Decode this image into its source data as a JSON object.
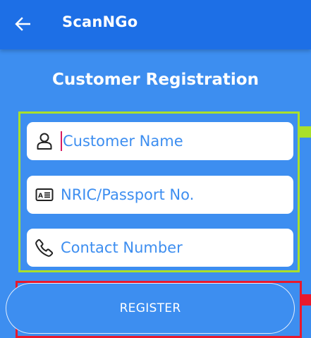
{
  "appbar": {
    "title": "ScanNGo",
    "back_icon": "arrow-left-icon",
    "color": "#1d6fe6"
  },
  "page": {
    "title": "Customer Registration",
    "background": "#3d8ef0"
  },
  "form": {
    "fields": [
      {
        "placeholder": "Customer Name",
        "icon": "person-icon"
      },
      {
        "placeholder": "NRIC/Passport No.",
        "icon": "id-card-icon"
      },
      {
        "placeholder": "Contact Number",
        "icon": "phone-icon"
      }
    ],
    "register_label": "REGISTER"
  },
  "annotations": {
    "fields_highlight_color": "#a9e02b",
    "button_highlight_color": "#e8192c"
  }
}
